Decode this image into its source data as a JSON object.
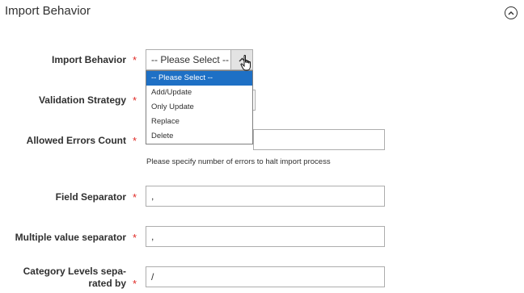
{
  "section": {
    "title": "Import Behavior",
    "collapse_icon": "chevron-up-circle-icon"
  },
  "fields": {
    "import_behavior": {
      "label": "Import Behavior",
      "required_mark": "*",
      "selected": "-- Please Select --",
      "options": [
        "-- Please Select --",
        "Add/Update",
        "Only Update",
        "Replace",
        "Delete"
      ]
    },
    "validation_strategy": {
      "label": "Validation Strategy",
      "required_mark": "*"
    },
    "allowed_errors": {
      "label": "Allowed Errors Count",
      "required_mark": "*",
      "value": "",
      "note": "Please specify number of errors to halt import process"
    },
    "field_separator": {
      "label": "Field Separator",
      "required_mark": "*",
      "value": ","
    },
    "multiple_value_separator": {
      "label": "Multiple value separator",
      "required_mark": "*",
      "value": ","
    },
    "category_levels": {
      "label_line1": "Category Levels sepa-",
      "label_line2": "rated by",
      "required_mark": "*",
      "value": "/"
    }
  },
  "colors": {
    "required": "#e02b27",
    "selected_option": "#1e70c5"
  }
}
